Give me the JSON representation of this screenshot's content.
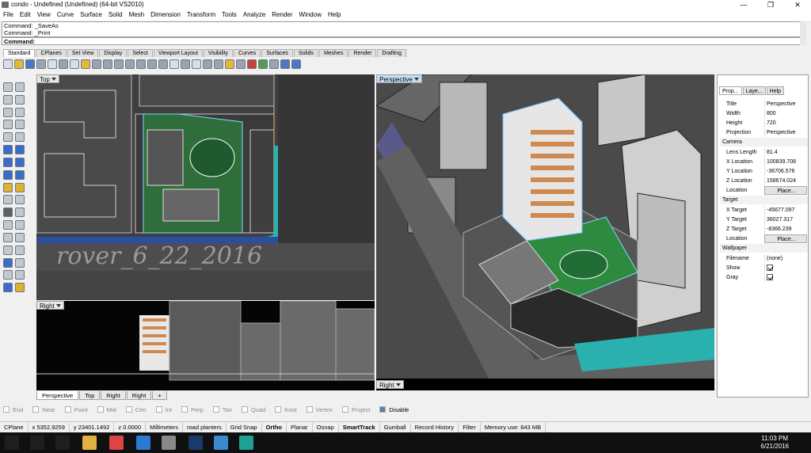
{
  "window": {
    "title": "condo - Undefined (Undefined) (64-bit VS2010)",
    "min": "—",
    "max": "❐",
    "close": "✕"
  },
  "menu": [
    "File",
    "Edit",
    "View",
    "Curve",
    "Surface",
    "Solid",
    "Mesh",
    "Dimension",
    "Transform",
    "Tools",
    "Analyze",
    "Render",
    "Window",
    "Help"
  ],
  "command": {
    "history": [
      "Command: _SaveAs",
      "Command: _Print"
    ],
    "prompt": "Command:"
  },
  "toolbar_tabs": [
    "Standard",
    "CPlanes",
    "Set View",
    "Display",
    "Select",
    "Viewport Layout",
    "Visibility",
    "Curves",
    "Surfaces",
    "Solids",
    "Meshes",
    "Render",
    "Drafting"
  ],
  "viewports": {
    "top": {
      "label": "Top",
      "watermark": "rover_6_22_2016"
    },
    "right": {
      "label": "Right"
    },
    "perspective": {
      "label": "Perspective"
    },
    "right2": {
      "label": "Right"
    }
  },
  "viewport_tabs": [
    "Perspective",
    "Top",
    "Right",
    "Right",
    "+"
  ],
  "properties": {
    "tabs": [
      "Prop...",
      "Laye...",
      "Help"
    ],
    "rows": [
      {
        "k": "Title",
        "v": "Perspective"
      },
      {
        "k": "Width",
        "v": "800"
      },
      {
        "k": "Height",
        "v": "720"
      },
      {
        "k": "Projection",
        "v": "Perspective"
      }
    ],
    "camera_label": "Camera",
    "camera": [
      {
        "k": "Lens Length",
        "v": "81.4"
      },
      {
        "k": "X Location",
        "v": "100839.708"
      },
      {
        "k": "Y Location",
        "v": "-36706.576"
      },
      {
        "k": "Z Location",
        "v": "158674.024"
      },
      {
        "k": "Location",
        "v": "Place..."
      }
    ],
    "target_label": "Target",
    "target": [
      {
        "k": "X Target",
        "v": "-45677.097"
      },
      {
        "k": "Y Target",
        "v": "36027.317"
      },
      {
        "k": "Z Target",
        "v": "-8366.239"
      },
      {
        "k": "Location",
        "v": "Place..."
      }
    ],
    "wallpaper_label": "Wallpaper",
    "wallpaper": [
      {
        "k": "Filename",
        "v": "(none)"
      },
      {
        "k": "Show",
        "v": ""
      },
      {
        "k": "Gray",
        "v": ""
      }
    ]
  },
  "osnap": [
    {
      "label": "End",
      "on": false
    },
    {
      "label": "Near",
      "on": false
    },
    {
      "label": "Point",
      "on": false
    },
    {
      "label": "Mid",
      "on": false
    },
    {
      "label": "Cen",
      "on": false
    },
    {
      "label": "Int",
      "on": false
    },
    {
      "label": "Perp",
      "on": false
    },
    {
      "label": "Tan",
      "on": false
    },
    {
      "label": "Quad",
      "on": false
    },
    {
      "label": "Knot",
      "on": false
    },
    {
      "label": "Vertex",
      "on": false
    },
    {
      "label": "Project",
      "on": false
    },
    {
      "label": "Disable",
      "on": true
    }
  ],
  "status": {
    "cplane": "CPlane",
    "x": "x 5352.9259",
    "y": "y 23401.1492",
    "z": "z 0.0000",
    "units": "Millimeters",
    "layer": "road planters",
    "items": [
      "Grid Snap",
      "Ortho",
      "Planar",
      "Osnap",
      "SmartTrack",
      "Gumball",
      "Record History",
      "Filter"
    ],
    "memory": "Memory use: 843 MB"
  },
  "clock": {
    "time": "11:03 PM",
    "date": "6/21/2016"
  }
}
